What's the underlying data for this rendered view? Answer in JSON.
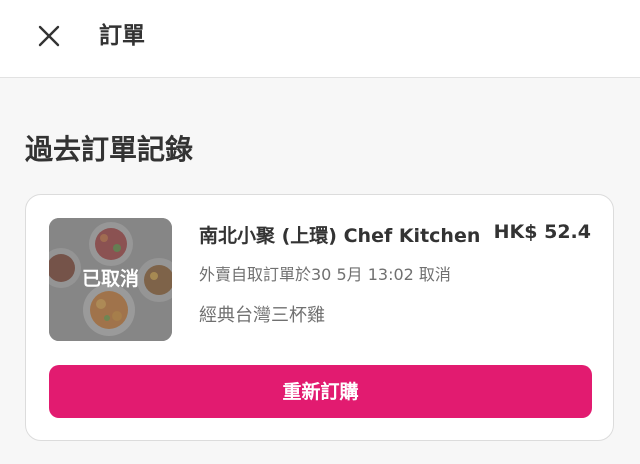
{
  "header": {
    "title": "訂單",
    "close_icon": "close-icon"
  },
  "section": {
    "title": "過去訂單記錄"
  },
  "orders": [
    {
      "thumbnail_status": "已取消",
      "restaurant": "南北小聚 (上環) Chef Kitchen",
      "price": "HK$ 52.4",
      "meta": "外賣自取訂單於30 5月 13:02 取消",
      "items": "經典台灣三杯雞",
      "reorder_label": "重新訂購"
    }
  ],
  "colors": {
    "accent": "#e21b70",
    "text_primary": "#333333",
    "text_secondary": "#707070",
    "background": "#f7f7f7"
  }
}
